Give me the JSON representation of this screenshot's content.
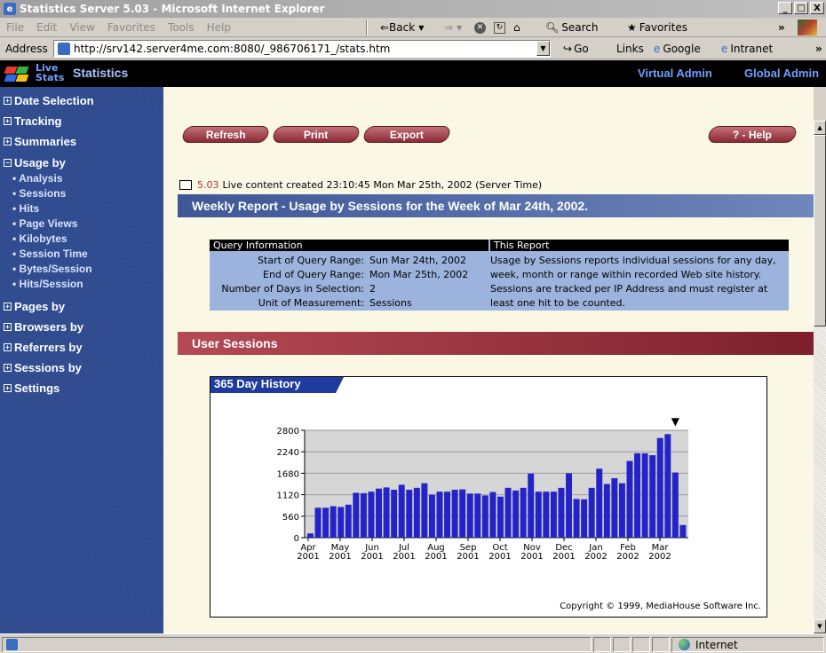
{
  "window": {
    "title": "Statistics Server 5.03 - Microsoft Internet Explorer",
    "minimize": "_",
    "maximize": "□",
    "close": "X"
  },
  "menubar": {
    "items": [
      "File",
      "Edit",
      "View",
      "Favorites",
      "Tools",
      "Help"
    ],
    "back": "⇐Back",
    "forward": "⇒",
    "search": "Search",
    "favorites": "Favorites",
    "more": "»"
  },
  "addressbar": {
    "label": "Address",
    "url": "http://srv142.server4me.com:8080/_986706171_/stats.htm",
    "go": "Go",
    "links": "Links",
    "google": "Google",
    "intranet": "Intranet"
  },
  "header": {
    "logo_live": "Live",
    "logo_stats": "Stats",
    "title": "Statistics",
    "virtual_admin": "Virtual Admin",
    "global_admin": "Global Admin"
  },
  "sidebar": {
    "items": [
      {
        "label": "Date Selection",
        "expanded": false
      },
      {
        "label": "Tracking",
        "expanded": false
      },
      {
        "label": "Summaries",
        "expanded": false
      },
      {
        "label": "Usage by",
        "expanded": true
      },
      {
        "label": "Pages by",
        "expanded": false
      },
      {
        "label": "Browsers by",
        "expanded": false
      },
      {
        "label": "Referrers by",
        "expanded": false
      },
      {
        "label": "Sessions by",
        "expanded": false
      },
      {
        "label": "Settings",
        "expanded": false
      }
    ],
    "usage_sub": [
      "Analysis",
      "Sessions",
      "Hits",
      "Page Views",
      "Kilobytes",
      "Session Time",
      "Bytes/Session",
      "Hits/Session"
    ]
  },
  "toolbar": {
    "refresh": "Refresh",
    "print": "Print",
    "export": "Export",
    "help": "? - Help"
  },
  "created": {
    "version": "5.03",
    "text": "Live content created 23:10:45 Mon Mar 25th, 2002 (Server Time)"
  },
  "report_title": "Weekly Report - Usage by Sessions for the Week of Mar 24th, 2002.",
  "query": {
    "header_left": "Query Information",
    "header_right": "This Report",
    "rows": [
      {
        "label": "Start of Query Range:",
        "value": "Sun Mar 24th, 2002"
      },
      {
        "label": "End of Query Range:",
        "value": "Mon Mar 25th, 2002"
      },
      {
        "label": "Number of Days in Selection:",
        "value": "2"
      },
      {
        "label": "Unit of Measurement:",
        "value": "Sessions"
      }
    ],
    "this_report": "Usage by Sessions reports individual sessions for any day, week, month or range within recorded Web site history. Sessions are tracked per IP Address and must register at least one hit to be counted."
  },
  "section_title": "User Sessions",
  "chart_tab": "365 Day History",
  "copyright": "Copyright © 1999, MediaHouse Software Inc.",
  "status": {
    "zone": "Internet"
  },
  "chart_data": {
    "type": "bar",
    "color": "#2323c8",
    "ylim": [
      0,
      2800
    ],
    "yticks": [
      0,
      560,
      1120,
      1680,
      2240,
      2800
    ],
    "xtick_labels": [
      [
        "Apr",
        "2001"
      ],
      [
        "May",
        "2001"
      ],
      [
        "Jun",
        "2001"
      ],
      [
        "Jul",
        "2001"
      ],
      [
        "Aug",
        "2001"
      ],
      [
        "Sep",
        "2001"
      ],
      [
        "Oct",
        "2001"
      ],
      [
        "Nov",
        "2001"
      ],
      [
        "Dec",
        "2001"
      ],
      [
        "Jan",
        "2002"
      ],
      [
        "Feb",
        "2002"
      ],
      [
        "Mar",
        "2002"
      ]
    ],
    "values": [
      110,
      780,
      780,
      820,
      800,
      860,
      1170,
      1160,
      1200,
      1280,
      1310,
      1250,
      1380,
      1250,
      1300,
      1420,
      1120,
      1200,
      1200,
      1250,
      1260,
      1150,
      1150,
      1100,
      1190,
      1070,
      1300,
      1230,
      1300,
      1670,
      1200,
      1200,
      1200,
      1300,
      1680,
      1010,
      1000,
      1300,
      1800,
      1400,
      1550,
      1420,
      2000,
      2200,
      2200,
      2150,
      2600,
      2700,
      1700,
      330
    ],
    "marker": "▼"
  }
}
